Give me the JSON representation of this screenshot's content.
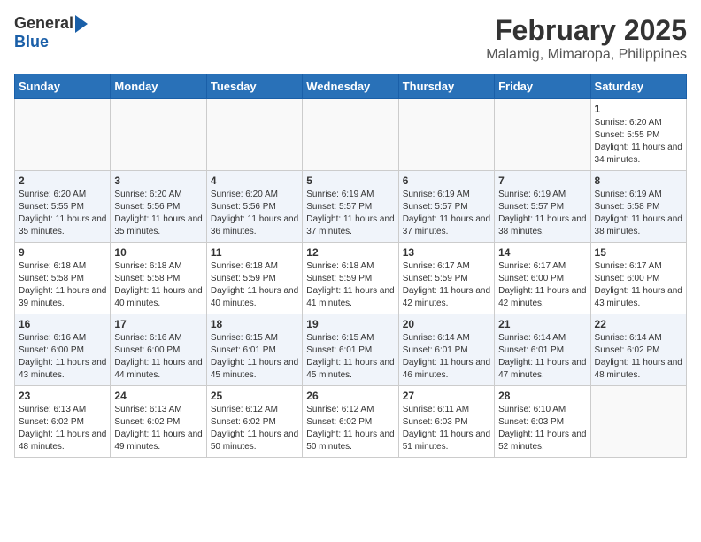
{
  "logo": {
    "general": "General",
    "blue": "Blue"
  },
  "title": "February 2025",
  "subtitle": "Malamig, Mimaropa, Philippines",
  "weekdays": [
    "Sunday",
    "Monday",
    "Tuesday",
    "Wednesday",
    "Thursday",
    "Friday",
    "Saturday"
  ],
  "weeks": [
    [
      {
        "day": "",
        "info": ""
      },
      {
        "day": "",
        "info": ""
      },
      {
        "day": "",
        "info": ""
      },
      {
        "day": "",
        "info": ""
      },
      {
        "day": "",
        "info": ""
      },
      {
        "day": "",
        "info": ""
      },
      {
        "day": "1",
        "info": "Sunrise: 6:20 AM\nSunset: 5:55 PM\nDaylight: 11 hours and 34 minutes."
      }
    ],
    [
      {
        "day": "2",
        "info": "Sunrise: 6:20 AM\nSunset: 5:55 PM\nDaylight: 11 hours and 35 minutes."
      },
      {
        "day": "3",
        "info": "Sunrise: 6:20 AM\nSunset: 5:56 PM\nDaylight: 11 hours and 35 minutes."
      },
      {
        "day": "4",
        "info": "Sunrise: 6:20 AM\nSunset: 5:56 PM\nDaylight: 11 hours and 36 minutes."
      },
      {
        "day": "5",
        "info": "Sunrise: 6:19 AM\nSunset: 5:57 PM\nDaylight: 11 hours and 37 minutes."
      },
      {
        "day": "6",
        "info": "Sunrise: 6:19 AM\nSunset: 5:57 PM\nDaylight: 11 hours and 37 minutes."
      },
      {
        "day": "7",
        "info": "Sunrise: 6:19 AM\nSunset: 5:57 PM\nDaylight: 11 hours and 38 minutes."
      },
      {
        "day": "8",
        "info": "Sunrise: 6:19 AM\nSunset: 5:58 PM\nDaylight: 11 hours and 38 minutes."
      }
    ],
    [
      {
        "day": "9",
        "info": "Sunrise: 6:18 AM\nSunset: 5:58 PM\nDaylight: 11 hours and 39 minutes."
      },
      {
        "day": "10",
        "info": "Sunrise: 6:18 AM\nSunset: 5:58 PM\nDaylight: 11 hours and 40 minutes."
      },
      {
        "day": "11",
        "info": "Sunrise: 6:18 AM\nSunset: 5:59 PM\nDaylight: 11 hours and 40 minutes."
      },
      {
        "day": "12",
        "info": "Sunrise: 6:18 AM\nSunset: 5:59 PM\nDaylight: 11 hours and 41 minutes."
      },
      {
        "day": "13",
        "info": "Sunrise: 6:17 AM\nSunset: 5:59 PM\nDaylight: 11 hours and 42 minutes."
      },
      {
        "day": "14",
        "info": "Sunrise: 6:17 AM\nSunset: 6:00 PM\nDaylight: 11 hours and 42 minutes."
      },
      {
        "day": "15",
        "info": "Sunrise: 6:17 AM\nSunset: 6:00 PM\nDaylight: 11 hours and 43 minutes."
      }
    ],
    [
      {
        "day": "16",
        "info": "Sunrise: 6:16 AM\nSunset: 6:00 PM\nDaylight: 11 hours and 43 minutes."
      },
      {
        "day": "17",
        "info": "Sunrise: 6:16 AM\nSunset: 6:00 PM\nDaylight: 11 hours and 44 minutes."
      },
      {
        "day": "18",
        "info": "Sunrise: 6:15 AM\nSunset: 6:01 PM\nDaylight: 11 hours and 45 minutes."
      },
      {
        "day": "19",
        "info": "Sunrise: 6:15 AM\nSunset: 6:01 PM\nDaylight: 11 hours and 45 minutes."
      },
      {
        "day": "20",
        "info": "Sunrise: 6:14 AM\nSunset: 6:01 PM\nDaylight: 11 hours and 46 minutes."
      },
      {
        "day": "21",
        "info": "Sunrise: 6:14 AM\nSunset: 6:01 PM\nDaylight: 11 hours and 47 minutes."
      },
      {
        "day": "22",
        "info": "Sunrise: 6:14 AM\nSunset: 6:02 PM\nDaylight: 11 hours and 48 minutes."
      }
    ],
    [
      {
        "day": "23",
        "info": "Sunrise: 6:13 AM\nSunset: 6:02 PM\nDaylight: 11 hours and 48 minutes."
      },
      {
        "day": "24",
        "info": "Sunrise: 6:13 AM\nSunset: 6:02 PM\nDaylight: 11 hours and 49 minutes."
      },
      {
        "day": "25",
        "info": "Sunrise: 6:12 AM\nSunset: 6:02 PM\nDaylight: 11 hours and 50 minutes."
      },
      {
        "day": "26",
        "info": "Sunrise: 6:12 AM\nSunset: 6:02 PM\nDaylight: 11 hours and 50 minutes."
      },
      {
        "day": "27",
        "info": "Sunrise: 6:11 AM\nSunset: 6:03 PM\nDaylight: 11 hours and 51 minutes."
      },
      {
        "day": "28",
        "info": "Sunrise: 6:10 AM\nSunset: 6:03 PM\nDaylight: 11 hours and 52 minutes."
      },
      {
        "day": "",
        "info": ""
      }
    ]
  ]
}
